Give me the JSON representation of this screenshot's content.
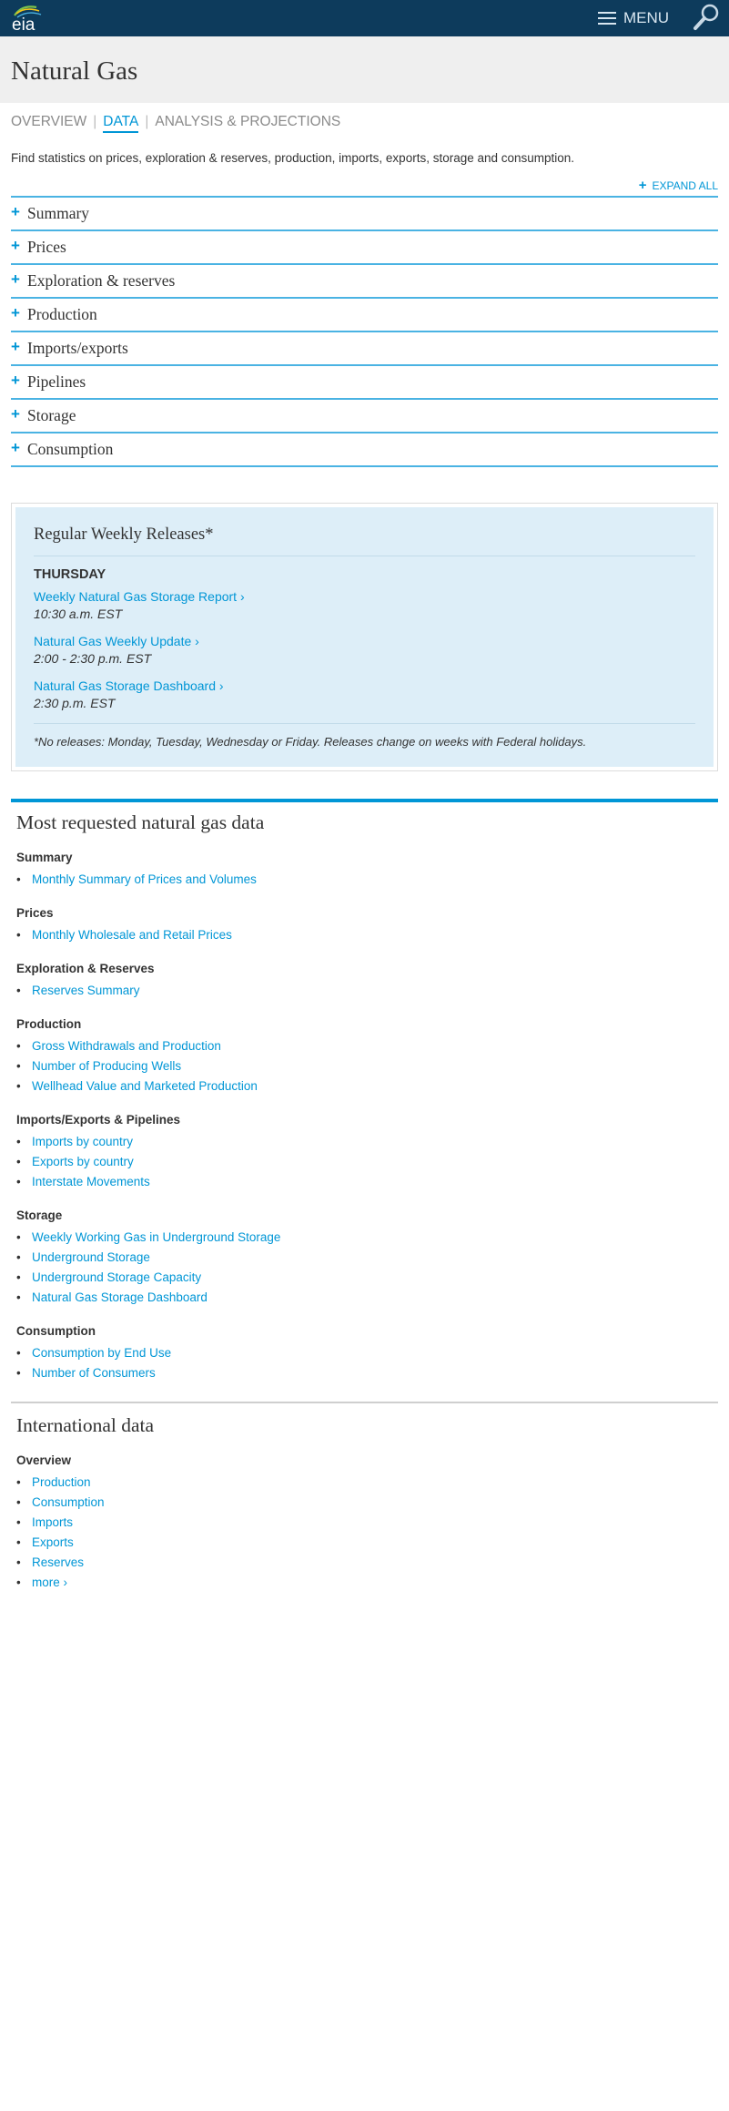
{
  "header": {
    "logo_text": "eia",
    "menu_label": "MENU",
    "colors": {
      "bar": "#0d3b5c",
      "accent": "#0096d6"
    }
  },
  "title": "Natural Gas",
  "tabs": [
    {
      "label": "OVERVIEW",
      "active": false
    },
    {
      "label": "DATA",
      "active": true
    },
    {
      "label": "ANALYSIS & PROJECTIONS",
      "active": false
    }
  ],
  "intro": "Find statistics on prices, exploration & reserves, production, imports, exports, storage and consumption.",
  "expand_all": "EXPAND ALL",
  "accordion": [
    "Summary",
    "Prices",
    "Exploration & reserves",
    "Production",
    "Imports/exports",
    "Pipelines",
    "Storage",
    "Consumption"
  ],
  "weekly": {
    "title": "Regular Weekly Releases*",
    "day": "THURSDAY",
    "releases": [
      {
        "link": "Weekly Natural Gas Storage Report ›",
        "time": "10:30 a.m. EST"
      },
      {
        "link": "Natural Gas Weekly Update ›",
        "time": "2:00 - 2:30 p.m. EST"
      },
      {
        "link": "Natural Gas Storage Dashboard ›",
        "time": "2:30 p.m. EST"
      }
    ],
    "note": "*No releases: Monday, Tuesday, Wednesday or Friday. Releases change on weeks with Federal holidays."
  },
  "most_requested": {
    "title": "Most requested natural gas data",
    "groups": [
      {
        "heading": "Summary",
        "links": [
          "Monthly Summary of Prices and Volumes"
        ]
      },
      {
        "heading": "Prices",
        "links": [
          "Monthly Wholesale and Retail Prices"
        ]
      },
      {
        "heading": "Exploration & Reserves",
        "links": [
          "Reserves Summary"
        ]
      },
      {
        "heading": "Production",
        "links": [
          "Gross Withdrawals and Production",
          "Number of Producing Wells",
          "Wellhead Value and Marketed Production"
        ]
      },
      {
        "heading": "Imports/Exports & Pipelines",
        "links": [
          "Imports by country",
          "Exports by country",
          "Interstate Movements"
        ]
      },
      {
        "heading": "Storage",
        "links": [
          "Weekly Working Gas in Underground Storage",
          "Underground Storage",
          "Underground Storage Capacity",
          "Natural Gas Storage Dashboard"
        ]
      },
      {
        "heading": "Consumption",
        "links": [
          "Consumption by End Use",
          "Number of Consumers"
        ]
      }
    ]
  },
  "international": {
    "title": "International data",
    "groups": [
      {
        "heading": "Overview",
        "links": [
          "Production",
          "Consumption",
          "Imports",
          "Exports",
          "Reserves",
          "more ›"
        ]
      }
    ]
  }
}
